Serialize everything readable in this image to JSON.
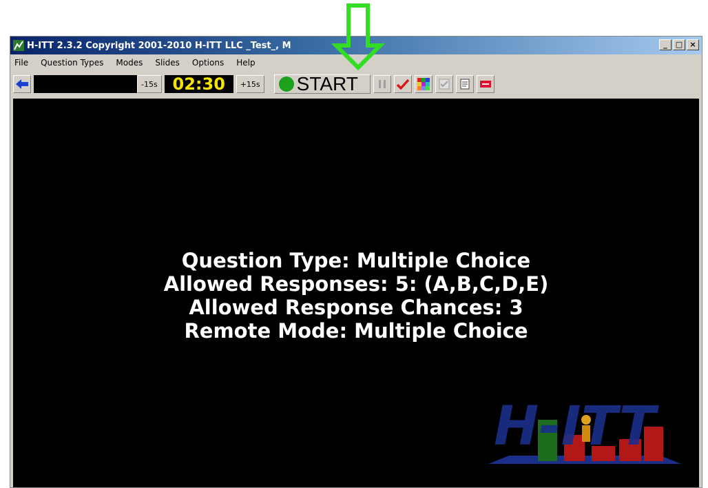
{
  "window": {
    "title": "H-ITT 2.3.2 Copyright 2001-2010 H-ITT LLC _Test_, M",
    "controls": {
      "minimize": "_",
      "maximize": "□",
      "close": "×"
    }
  },
  "menu": [
    "File",
    "Question Types",
    "Modes",
    "Slides",
    "Options",
    "Help"
  ],
  "toolbar": {
    "minus_label": "-15s",
    "timer": "02:30",
    "plus_label": "+15s",
    "start_label": "START"
  },
  "screen": {
    "lines": [
      "Question Type: Multiple Choice",
      "Allowed Responses: 5: (A,B,C,D,E)",
      "Allowed Response Chances: 3",
      "Remote Mode: Multiple Choice"
    ],
    "logo": "H-ITT"
  },
  "colors": {
    "annotation_arrow": "#33dd22",
    "timer_text": "#f5e400",
    "start_dot": "#1da01d",
    "logo_blue": "#1a2f8a"
  }
}
